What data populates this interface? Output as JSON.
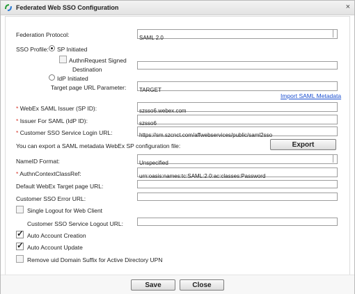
{
  "window": {
    "title": "Federated Web SSO Configuration",
    "close_glyph": "×"
  },
  "fields": {
    "federation_protocol": {
      "label": "Federation Protocol:",
      "value": "SAML 2.0"
    },
    "sso_profile": {
      "label": "SSO Profile:",
      "sp_initiated": "SP Initiated",
      "authn_signed": "AuthnRequest Signed",
      "destination": "Destination",
      "idp_initiated": "IdP Initiated",
      "target_param_label": "Target page URL Parameter:",
      "target_param_value": "TARGET"
    },
    "import_link": "Import SAML Metadata",
    "sp_id": {
      "req": "*",
      "label": "WebEx SAML Issuer (SP ID):",
      "value": "szsso6.webex.com"
    },
    "idp_id": {
      "req": "*",
      "label": "Issuer For SAML (IdP ID):",
      "value": "szsso6"
    },
    "login_url": {
      "req": "*",
      "label": "Customer SSO Service Login URL:",
      "value": "https://sm.szcnct.com/affwebservices/public/saml2sso"
    },
    "export_text": "You can export a SAML metadata WebEx SP configuration file:",
    "export_button": "Export",
    "nameid": {
      "label": "NameID Format:",
      "value": "Unspecified"
    },
    "authn_ref": {
      "req": "*",
      "label": "AuthnContextClassRef:",
      "value": "urn:oasis:names:tc:SAML:2.0:ac:classes:Password"
    },
    "default_target": {
      "label": "Default WebEx Target page URL:"
    },
    "error_url": {
      "label": "Customer SSO Error URL:"
    },
    "single_logout": {
      "label": "Single Logout for Web Client"
    },
    "logout_url": {
      "label": "Customer SSO Service Logout URL:"
    },
    "auto_create": {
      "label": "Auto Account Creation"
    },
    "auto_update": {
      "label": "Auto Account Update"
    },
    "remove_uid": {
      "label": "Remove uid Domain Suffix for Active Directory UPN"
    }
  },
  "buttons": {
    "save": "Save",
    "close": "Close"
  },
  "colors": {
    "required": "#d6362a",
    "link": "#1a4fd0"
  }
}
